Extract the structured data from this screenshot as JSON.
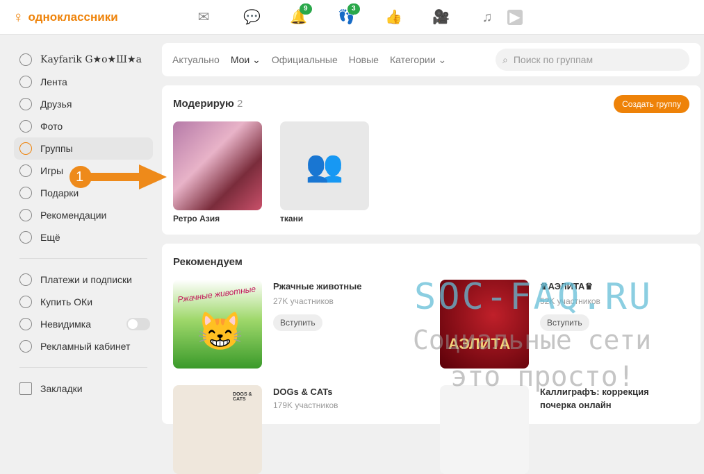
{
  "header": {
    "logo": "одноклассники",
    "badges": {
      "notifications": "9",
      "guests": "3"
    }
  },
  "sidebar": {
    "items": [
      {
        "label": "Kayfarik G★o★Ш★a"
      },
      {
        "label": "Лента"
      },
      {
        "label": "Друзья"
      },
      {
        "label": "Фото"
      },
      {
        "label": "Группы"
      },
      {
        "label": "Игры"
      },
      {
        "label": "Подарки"
      },
      {
        "label": "Рекомендации"
      },
      {
        "label": "Ещё"
      },
      {
        "label": "Платежи и подписки"
      },
      {
        "label": "Купить ОКи"
      },
      {
        "label": "Невидимка"
      },
      {
        "label": "Рекламный кабинет"
      },
      {
        "label": "Закладки"
      }
    ]
  },
  "tabs": [
    {
      "label": "Актуально"
    },
    {
      "label": "Мои ⌄"
    },
    {
      "label": "Официальные"
    },
    {
      "label": "Новые"
    },
    {
      "label": "Категории ⌄"
    }
  ],
  "search": {
    "placeholder": "Поиск по группам"
  },
  "moderate": {
    "title": "Модерирую",
    "count": "2",
    "create_label": "Создать группу",
    "groups": [
      {
        "name": "Ретро Азия"
      },
      {
        "name": "ткани"
      }
    ]
  },
  "annotation": "1",
  "recommend": {
    "title": "Рекомендуем",
    "join_label": "Вступить",
    "groups": [
      {
        "name": "Ржачные животные",
        "members": "27K участников",
        "img_text": "Ржачные животные"
      },
      {
        "name": "♛АЭЛИТА♛",
        "members": "52K участников",
        "img_text": "АЭЛИТА"
      },
      {
        "name": "DOGs & CATs",
        "members": "179K участников",
        "img_text": "DOGS & CATS"
      },
      {
        "name": "Каллиграфъ: коррекция почерка онлайн"
      }
    ]
  },
  "watermark": {
    "line1": "SOC-FAQ.RU",
    "line2": "Социальные сети",
    "line3": "это просто!"
  },
  "colors": {
    "accent": "#ee8208",
    "badge": "#2aa84a"
  }
}
